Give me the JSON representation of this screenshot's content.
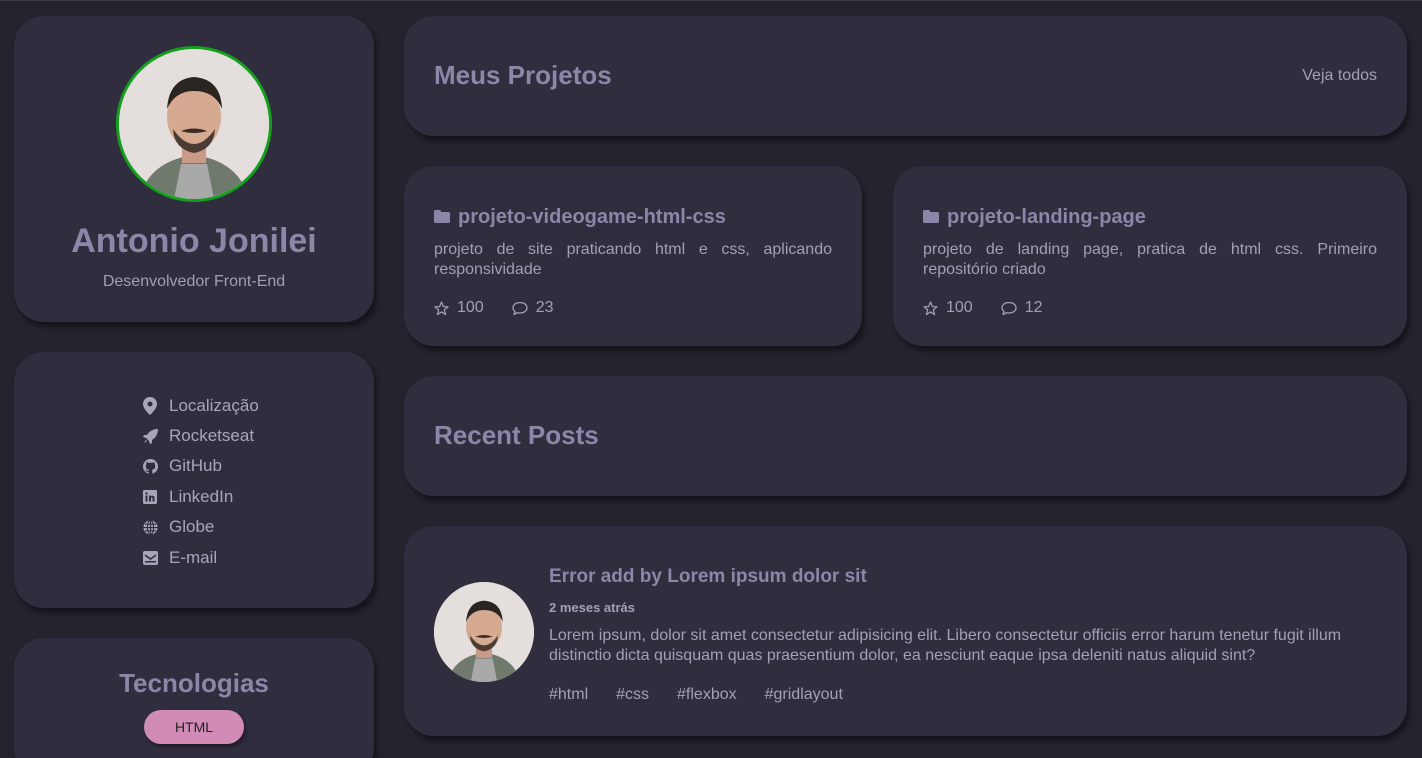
{
  "profile": {
    "name": "Antonio Jonilei",
    "role": "Desenvolvedor Front-End"
  },
  "links": [
    {
      "label": "Localização",
      "icon": "map-pin-icon"
    },
    {
      "label": "Rocketseat",
      "icon": "rocket-icon"
    },
    {
      "label": "GitHub",
      "icon": "github-icon"
    },
    {
      "label": "LinkedIn",
      "icon": "linkedin-icon"
    },
    {
      "label": "Globe",
      "icon": "globe-icon"
    },
    {
      "label": "E-mail",
      "icon": "email-icon"
    }
  ],
  "tech": {
    "title": "Tecnologias",
    "badges": [
      "HTML"
    ],
    "badge_color": "#d08cb7"
  },
  "projects": {
    "title": "Meus Projetos",
    "see_all": "Veja todos",
    "items": [
      {
        "name": "projeto-videogame-html-css",
        "description": "projeto de site praticando html e css, aplicando responsividade",
        "stars": "100",
        "comments": "23"
      },
      {
        "name": "projeto-landing-page",
        "description": "projeto de landing page, pratica de html css. Primeiro repositório criado",
        "stars": "100",
        "comments": "12"
      }
    ]
  },
  "posts": {
    "title": "Recent Posts",
    "items": [
      {
        "title": "Error add by Lorem ipsum dolor sit",
        "time": "2 meses atrás",
        "body": "Lorem ipsum, dolor sit amet consectetur adipisicing elit. Libero consectetur officiis error harum tenetur fugit illum distinctio dicta quisquam quas praesentium dolor, ea nesciunt eaque ipsa deleniti natus aliquid sint?",
        "tags": [
          "#html",
          "#css",
          "#flexbox",
          "#gridlayout"
        ]
      }
    ]
  },
  "colors": {
    "background": "#25232e",
    "card": "#302e3e",
    "avatar_border": "#14a01e",
    "heading": "#8a87a8"
  }
}
